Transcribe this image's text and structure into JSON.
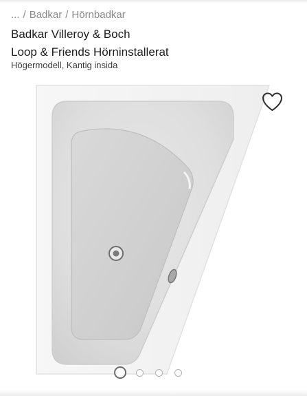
{
  "breadcrumb": {
    "items": [
      "...",
      "Badkar",
      "Hörnbadkar"
    ],
    "separator": "/"
  },
  "product": {
    "title_line1": "Badkar Villeroy & Boch",
    "title_line2": "Loop & Friends Hörninstallerat",
    "subtitle": "Högermodell, Kantig insida"
  },
  "gallery": {
    "image": "corner-bathtub-image",
    "favorite_icon": "heart-icon",
    "pagination": {
      "total": 4,
      "active_index": 0
    }
  },
  "colors": {
    "text_primary": "#1c1c1c",
    "text_muted": "#8a8a8a",
    "dot_active": "#6a6a6a",
    "dot_inactive": "#b0b0b0"
  }
}
